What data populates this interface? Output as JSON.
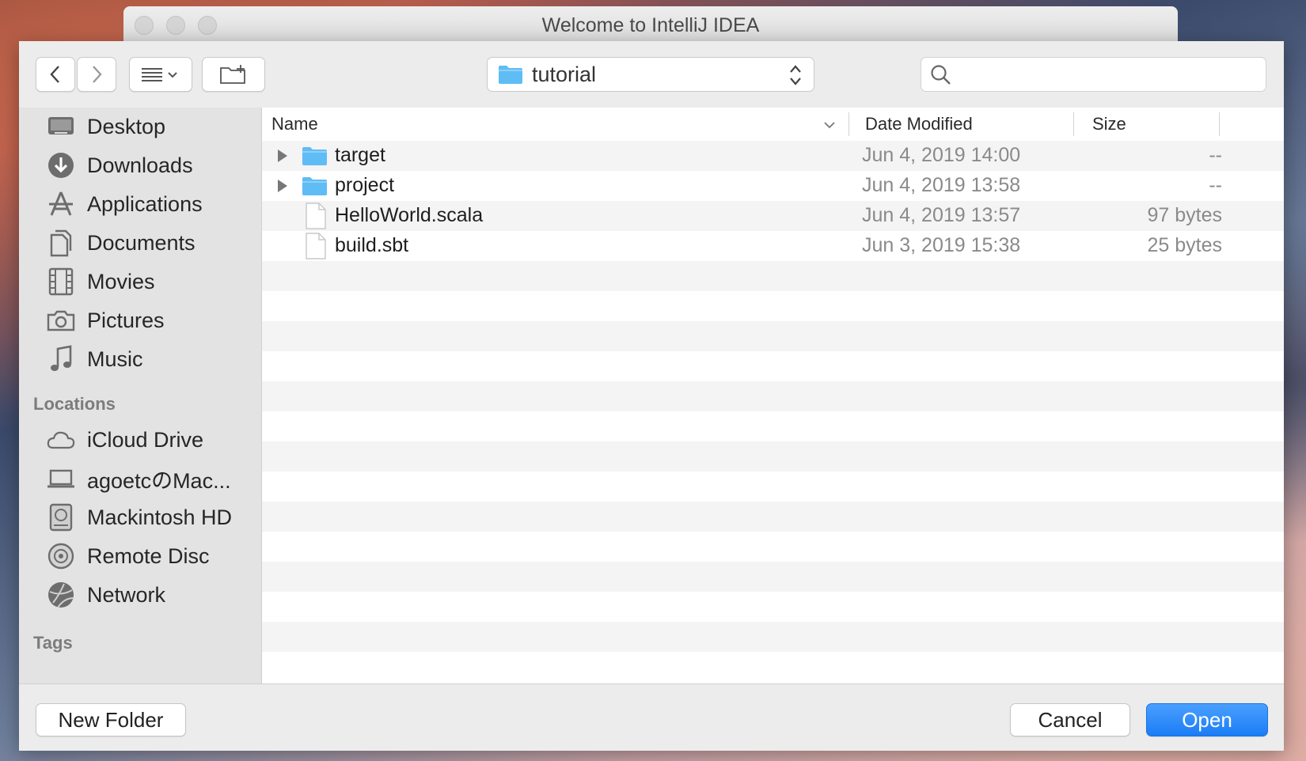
{
  "window": {
    "title": "Welcome to IntelliJ IDEA"
  },
  "toolbar": {
    "back_icon": "chevron-left-icon",
    "forward_icon": "chevron-right-icon",
    "view_icon": "list-view-icon",
    "new_folder_icon": "new-folder-icon",
    "path": "tutorial",
    "search_placeholder": ""
  },
  "sidebar": {
    "favorites": [
      {
        "label": "Desktop",
        "icon": "desktop-icon"
      },
      {
        "label": "Downloads",
        "icon": "downloads-icon"
      },
      {
        "label": "Applications",
        "icon": "applications-icon"
      },
      {
        "label": "Documents",
        "icon": "documents-icon"
      },
      {
        "label": "Movies",
        "icon": "movies-icon"
      },
      {
        "label": "Pictures",
        "icon": "pictures-icon"
      },
      {
        "label": "Music",
        "icon": "music-icon"
      }
    ],
    "locations_heading": "Locations",
    "locations": [
      {
        "label": "iCloud Drive",
        "icon": "cloud-icon"
      },
      {
        "label": "agoetcのMac...",
        "icon": "laptop-icon"
      },
      {
        "label": "Mackintosh HD",
        "icon": "hard-drive-icon"
      },
      {
        "label": "Remote Disc",
        "icon": "disc-icon"
      },
      {
        "label": "Network",
        "icon": "network-icon"
      }
    ],
    "tags_heading": "Tags"
  },
  "columns": {
    "name": "Name",
    "date": "Date Modified",
    "size": "Size"
  },
  "files": [
    {
      "name": "target",
      "date": "Jun 4, 2019 14:00",
      "size": "--",
      "kind": "folder"
    },
    {
      "name": "project",
      "date": "Jun 4, 2019 13:58",
      "size": "--",
      "kind": "folder"
    },
    {
      "name": "HelloWorld.scala",
      "date": "Jun 4, 2019 13:57",
      "size": "97 bytes",
      "kind": "file"
    },
    {
      "name": "build.sbt",
      "date": "Jun 3, 2019 15:38",
      "size": "25 bytes",
      "kind": "file"
    }
  ],
  "buttons": {
    "new_folder": "New Folder",
    "cancel": "Cancel",
    "open": "Open"
  },
  "colors": {
    "accent": "#1b7cf5",
    "folder": "#5fbcf5"
  }
}
